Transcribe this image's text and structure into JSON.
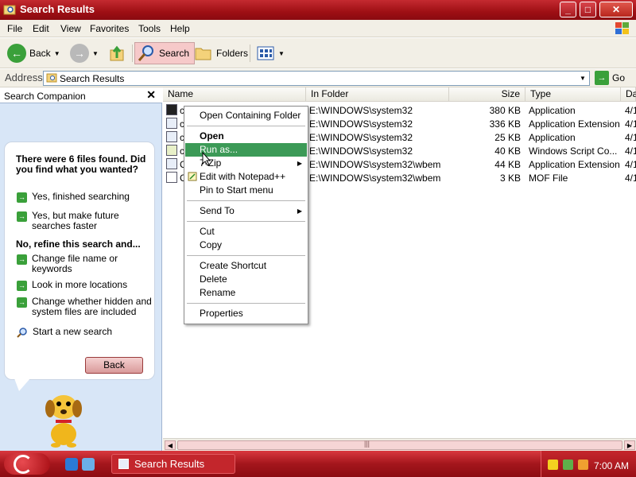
{
  "window": {
    "title": "Search Results"
  },
  "colors": {
    "accent": "#b3151b",
    "highlight": "#3c9a57",
    "pane": "#d8e6f7"
  },
  "menu": [
    "File",
    "Edit",
    "View",
    "Favorites",
    "Tools",
    "Help"
  ],
  "toolbar": {
    "back": "Back",
    "search": "Search",
    "folders": "Folders"
  },
  "address": {
    "label": "Address",
    "value": "Search Results",
    "go": "Go"
  },
  "left_pane": {
    "title": "Search Companion",
    "heading": "There were 6 files found. Did you find what you wanted?",
    "yes_options": [
      "Yes, finished searching",
      "Yes, but make future searches faster"
    ],
    "refine_heading": "No, refine this search and...",
    "refine_options": [
      "Change file name or keywords",
      "Look in more locations",
      "Change whether hidden and system files are included"
    ],
    "new_search": "Start a new search",
    "back_button": "Back"
  },
  "columns": {
    "name": "Name",
    "folder": "In Folder",
    "size": "Size",
    "type": "Type",
    "date": "Da"
  },
  "files": [
    {
      "name": "c",
      "folder": "E:\\WINDOWS\\system32",
      "size": "380 KB",
      "type": "Application",
      "date": "4/1"
    },
    {
      "name": "c",
      "folder": "E:\\WINDOWS\\system32",
      "size": "336 KB",
      "type": "Application Extension",
      "date": "4/1"
    },
    {
      "name": "c",
      "folder": "E:\\WINDOWS\\system32",
      "size": "25 KB",
      "type": "Application",
      "date": "4/1"
    },
    {
      "name": "c",
      "folder": "E:\\WINDOWS\\system32",
      "size": "40 KB",
      "type": "Windows Script Co...",
      "date": "4/1"
    },
    {
      "name": "C",
      "folder": "E:\\WINDOWS\\system32\\wbem",
      "size": "44 KB",
      "type": "Application Extension",
      "date": "4/1"
    },
    {
      "name": "C",
      "folder": "E:\\WINDOWS\\system32\\wbem",
      "size": "3 KB",
      "type": "MOF File",
      "date": "4/1"
    }
  ],
  "context_menu": {
    "open_folder": "Open Containing Folder",
    "open": "Open",
    "run_as": "Run as...",
    "zip": "7-Zip",
    "notepad": "Edit with Notepad++",
    "pin": "Pin to Start menu",
    "send_to": "Send To",
    "cut": "Cut",
    "copy": "Copy",
    "shortcut": "Create Shortcut",
    "delete": "Delete",
    "rename": "Rename",
    "properties": "Properties"
  },
  "taskbar": {
    "task": "Search Results",
    "clock": "7:00 AM"
  }
}
